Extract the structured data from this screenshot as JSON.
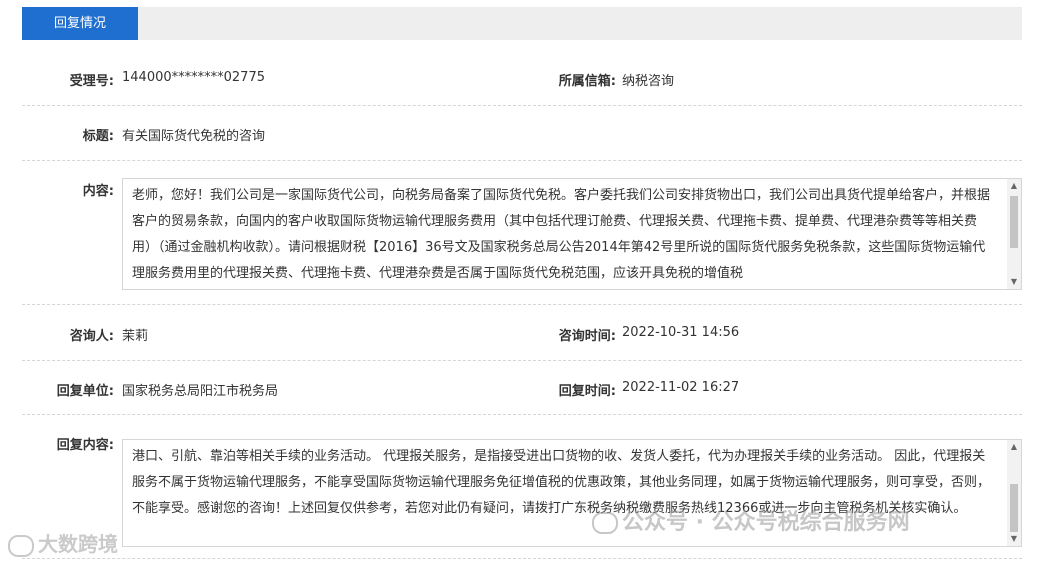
{
  "header": {
    "tab_label": "回复情况"
  },
  "fields": {
    "accept_no_label": "受理号:",
    "accept_no_value": "144000********02775",
    "mailbox_label": "所属信箱:",
    "mailbox_value": "纳税咨询",
    "title_label": "标题:",
    "title_value": "有关国际货代免税的咨询",
    "content_label": "内容:",
    "content_value": "老师，您好！我们公司是一家国际货代公司，向税务局备案了国际货代免税。客户委托我们公司安排货物出口，我们公司出具货代提单给客户，并根据客户的贸易条款，向国内的客户收取国际货物运输代理服务费用（其中包括代理订舱费、代理报关费、代理拖卡费、提单费、代理港杂费等等相关费用）（通过金融机构收款）。请问根据财税【2016】36号文及国家税务总局公告2014年第42号里所说的国际货代服务免税条款，这些国际货物运输代理服务费用里的代理报关费、代理拖卡费、代理港杂费是否属于国际货代免税范围，应该开具免税的增值税",
    "consultant_label": "咨询人:",
    "consultant_value": "茉莉",
    "consult_time_label": "咨询时间:",
    "consult_time_value": "2022-10-31 14:56",
    "reply_unit_label": "回复单位:",
    "reply_unit_value": "国家税务总局阳江市税务局",
    "reply_time_label": "回复时间:",
    "reply_time_value": "2022-11-02 16:27",
    "reply_content_label": "回复内容:",
    "reply_content_value": "港口、引航、靠泊等相关手续的业务活动。 代理报关服务，是指接受进出口货物的收、发货人委托，代为办理报关手续的业务活动。 因此，代理报关服务不属于货物运输代理服务，不能享受国际货物运输代理服务免征增值税的优惠政策，其他业务同理，如属于货物运输代理服务，则可享受，否则，不能享受。感谢您的咨询！上述回复仅供参考，若您对此仍有疑问，请拨打广东税务纳税缴费服务热线12366或进一步向主管税务机关核实确认。"
  },
  "watermarks": {
    "left": "大数跨境",
    "right": "公众号 · 公众号税综合服务网"
  },
  "colors": {
    "accent": "#1f6fd0",
    "header_bg": "#eeeeee",
    "divider": "#d6d6d6"
  }
}
